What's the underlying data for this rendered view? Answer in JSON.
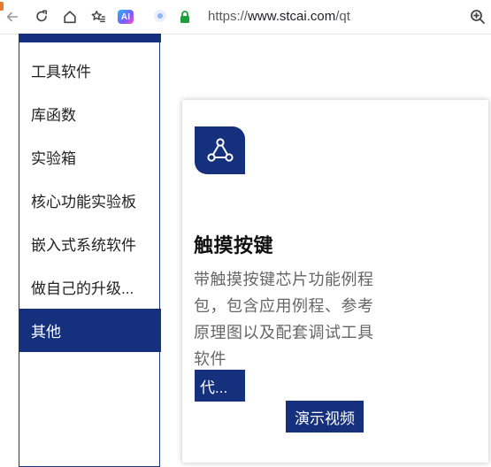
{
  "browser": {
    "url_scheme": "https://",
    "url_host": "www.stcai.com",
    "url_path": "/qt",
    "ai_badge": "AI"
  },
  "sidebar": {
    "items": [
      {
        "label": "工具软件",
        "active": false
      },
      {
        "label": "库函数",
        "active": false
      },
      {
        "label": "实验箱",
        "active": false
      },
      {
        "label": "核心功能实验板",
        "active": false
      },
      {
        "label": "嵌入式系统软件",
        "active": false
      },
      {
        "label": "做自己的升级...",
        "active": false
      },
      {
        "label": "其他",
        "active": true
      }
    ]
  },
  "card": {
    "title": "触摸按键",
    "description": "带触摸按键芯片功能例程包，包含应用例程、参考原理图以及配套调试工具软件",
    "code_button": "代...",
    "demo_button": "演示视频"
  },
  "colors": {
    "brand_blue": "#15307c",
    "tab_accent": "#e57a2c"
  },
  "icons": [
    "back-icon",
    "refresh-icon",
    "home-icon",
    "favorites-icon",
    "ai-badge",
    "lock-icon",
    "zoom-icon",
    "share-nodes-icon"
  ]
}
